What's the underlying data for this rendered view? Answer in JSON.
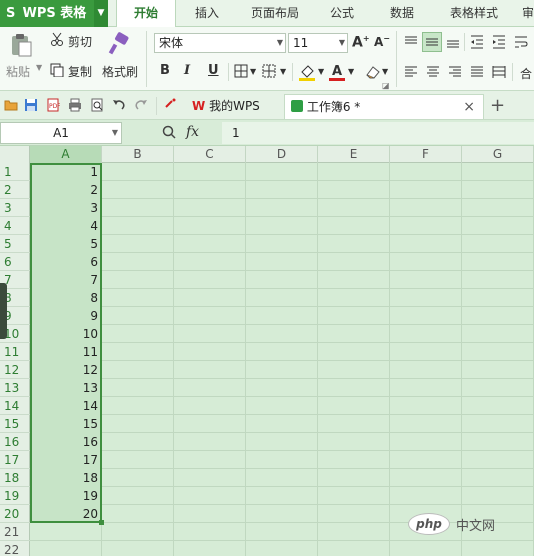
{
  "app": {
    "title": "WPS 表格",
    "logo": "S"
  },
  "menu": {
    "tabs": [
      {
        "label": "开始",
        "active": true
      },
      {
        "label": "插入"
      },
      {
        "label": "页面布局"
      },
      {
        "label": "公式"
      },
      {
        "label": "数据"
      },
      {
        "label": "表格样式"
      },
      {
        "label": "审"
      }
    ]
  },
  "ribbon": {
    "paste": "粘贴",
    "cut": "剪切",
    "copy": "复制",
    "format_painter": "格式刷",
    "font_name": "宋体",
    "font_size": "11",
    "bold": "B",
    "italic": "I",
    "underline": "U",
    "merge": "合"
  },
  "quick_access": {
    "doc_tabs": [
      {
        "label": "我的WPS"
      },
      {
        "label": "工作簿6 *"
      }
    ],
    "close_glyph": "×",
    "new_tab_glyph": "+"
  },
  "formula_bar": {
    "name_box": "A1",
    "fx": "fx",
    "value": "1"
  },
  "sheet": {
    "columns": [
      "A",
      "B",
      "C",
      "D",
      "E",
      "F",
      "G"
    ],
    "rows": [
      "1",
      "2",
      "3",
      "4",
      "5",
      "6",
      "7",
      "8",
      "9",
      "10",
      "11",
      "12",
      "13",
      "14",
      "15",
      "16",
      "17",
      "18",
      "19",
      "20",
      "21",
      "22"
    ],
    "column_a_values": [
      "1",
      "2",
      "3",
      "4",
      "5",
      "6",
      "7",
      "8",
      "9",
      "10",
      "11",
      "12",
      "13",
      "14",
      "15",
      "16",
      "17",
      "18",
      "19",
      "20"
    ]
  },
  "watermark": {
    "logo": "php",
    "text": "中文网"
  },
  "colors": {
    "accent": "#3a9a3e",
    "selection_border": "#3f8f3f",
    "grid_bg": "#d6ecd6"
  }
}
